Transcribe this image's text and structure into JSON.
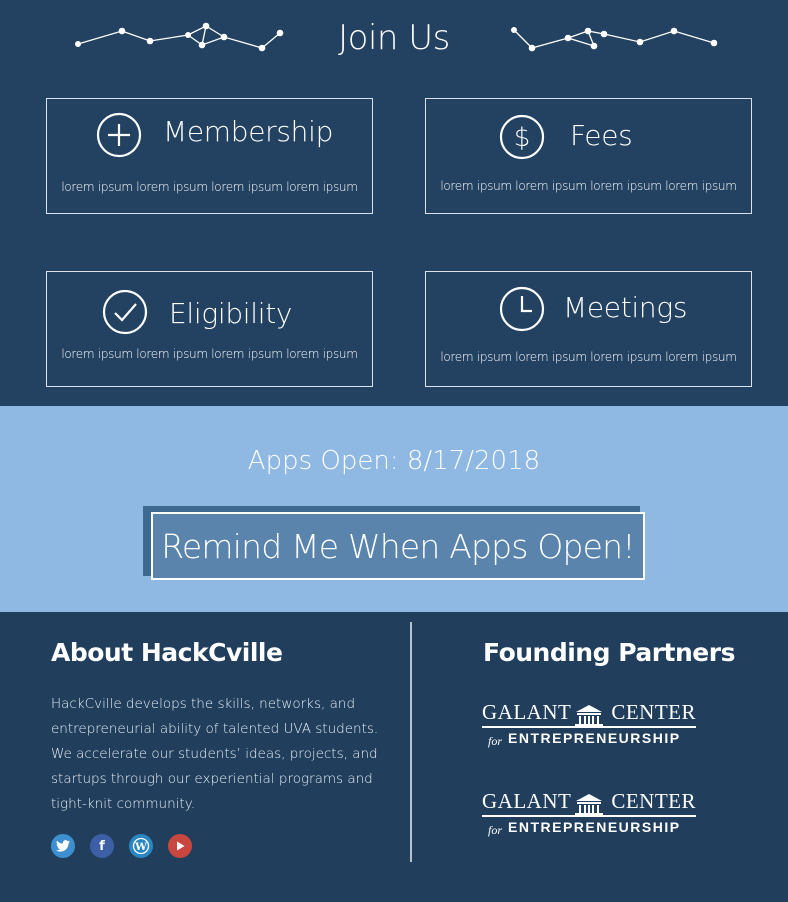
{
  "join": {
    "title": "Join Us",
    "cards": [
      {
        "title": "Membership",
        "desc": "lorem ipsum lorem ipsum lorem ipsum lorem ipsum",
        "icon": "plus-circle-icon"
      },
      {
        "title": "Fees",
        "desc": "lorem ipsum lorem ipsum lorem ipsum lorem ipsum",
        "icon": "dollar-circle-icon"
      },
      {
        "title": "Eligibility",
        "desc": "lorem ipsum lorem ipsum lorem ipsum lorem ipsum",
        "icon": "check-circle-icon"
      },
      {
        "title": "Meetings",
        "desc": "lorem ipsum lorem ipsum lorem ipsum lorem ipsum",
        "icon": "clock-icon"
      }
    ]
  },
  "apps": {
    "open_label": "Apps Open:  8/17/2018",
    "remind_label": "Remind Me When Apps Open!"
  },
  "about": {
    "title": "About HackCville",
    "text": "HackCville develops the skills, networks, and entrepreneurial ability of talented UVA students. We accelerate our students’ ideas, projects, and startups through our experiential programs and tight-knit community.",
    "social": [
      {
        "name": "twitter-icon",
        "glyph": "t",
        "color": "#3e8fd0"
      },
      {
        "name": "facebook-icon",
        "glyph": "f",
        "color": "#3c5fa6"
      },
      {
        "name": "wordpress-icon",
        "glyph": "W",
        "color": "#2a86c1"
      },
      {
        "name": "youtube-icon",
        "glyph": "▶",
        "color": "#c9473f"
      }
    ]
  },
  "partners": {
    "title": "Founding Partners",
    "logos": [
      {
        "word1": "GALANT",
        "word2": "CENTER",
        "for": "for",
        "entre": "ENTREPRENEURSHIP"
      },
      {
        "word1": "GALANT",
        "word2": "CENTER",
        "for": "for",
        "entre": "ENTREPRENEURSHIP"
      }
    ]
  },
  "colors": {
    "navy": "#234160",
    "light_blue": "#8fb8e3",
    "button": "#5a84ac"
  }
}
